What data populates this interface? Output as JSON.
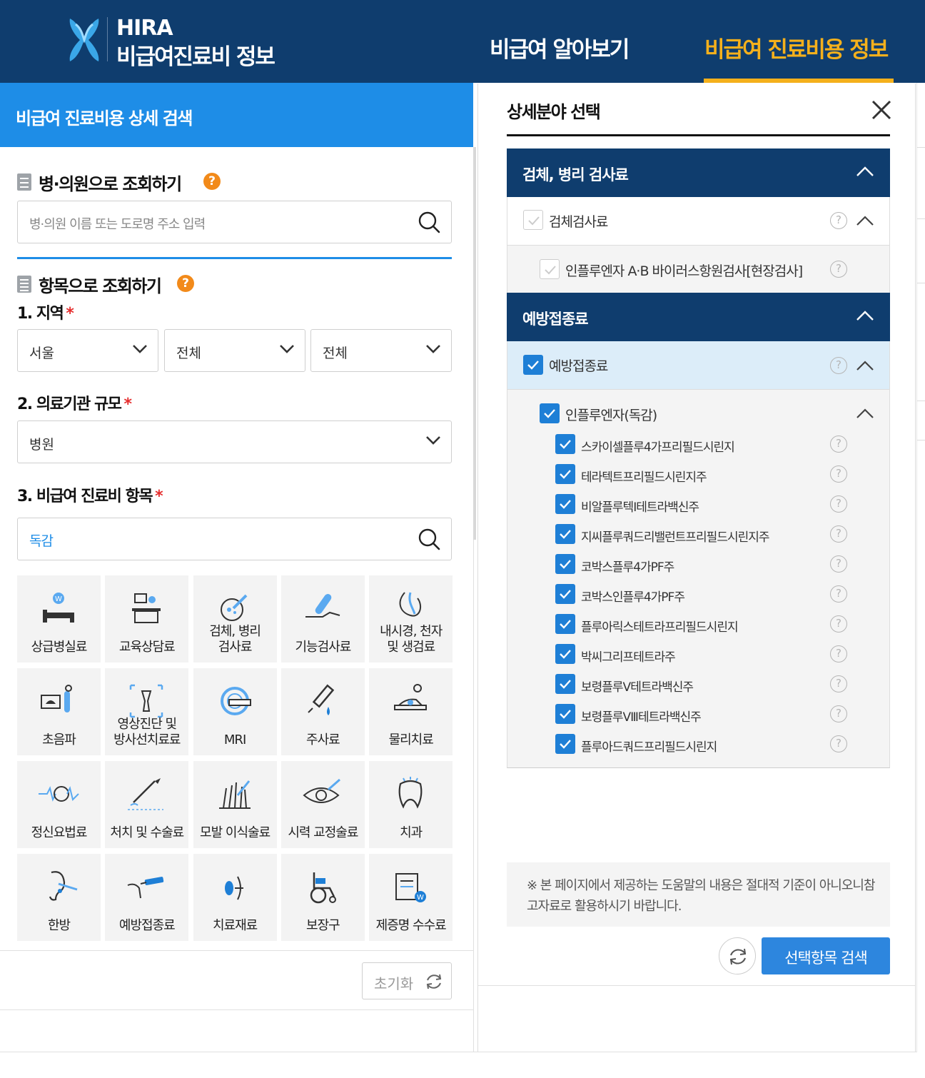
{
  "header": {
    "logo_top": "HIRA",
    "logo_bottom": "비급여진료비 정보",
    "nav": [
      "비급여 알아보기",
      "비급여 진료비용 정보"
    ]
  },
  "left": {
    "title": "비급여 진료비용 상세 검색",
    "hospital_section": {
      "title": "병·의원으로 조회하기",
      "placeholder": "병·의원 이름 또는 도로명 주소 입력"
    },
    "item_section": {
      "title": "항목으로 조회하기",
      "region_label": "1. 지역",
      "region_values": [
        "서울",
        "전체",
        "전체"
      ],
      "scale_label": "2. 의료기관 규모",
      "scale_value": "병원",
      "item_label": "3. 비급여 진료비 항목",
      "item_value": "독감"
    },
    "tiles": [
      {
        "label": "상급병실료",
        "icon": "bed-icon"
      },
      {
        "label": "교육상담료",
        "icon": "consult-icon"
      },
      {
        "label": "검체, 병리\n검사료",
        "icon": "specimen-icon"
      },
      {
        "label": "기능검사료",
        "icon": "thermometer-icon"
      },
      {
        "label": "내시경, 천자\n및 생검료",
        "icon": "endoscope-icon"
      },
      {
        "label": "초음파",
        "icon": "ultrasound-icon"
      },
      {
        "label": "영상진단 및\n방사선치료료",
        "icon": "xray-icon"
      },
      {
        "label": "MRI",
        "icon": "mri-icon"
      },
      {
        "label": "주사료",
        "icon": "syringe-icon"
      },
      {
        "label": "물리치료",
        "icon": "physio-icon"
      },
      {
        "label": "정신요법료",
        "icon": "brain-icon"
      },
      {
        "label": "처치 및 수술료",
        "icon": "scalpel-icon"
      },
      {
        "label": "모발 이식술료",
        "icon": "hair-icon"
      },
      {
        "label": "시력 교정술료",
        "icon": "eye-icon"
      },
      {
        "label": "치과",
        "icon": "tooth-icon"
      },
      {
        "label": "한방",
        "icon": "ear-acupuncture-icon"
      },
      {
        "label": "예방접종료",
        "icon": "vaccine-icon"
      },
      {
        "label": "치료재료",
        "icon": "material-icon"
      },
      {
        "label": "보장구",
        "icon": "wheelchair-icon"
      },
      {
        "label": "제증명 수수료",
        "icon": "certificate-icon"
      }
    ],
    "reset_label": "초기화"
  },
  "modal": {
    "title": "상세분야 선택",
    "categories": [
      {
        "title": "검체, 병리 검사료",
        "sub": {
          "label": "검체검사료",
          "checked": false
        },
        "items": [
          {
            "label": "인플루엔자 A·B 바이러스항원검사[현장검사]",
            "checked": false
          }
        ]
      },
      {
        "title": "예방접종료",
        "sub": {
          "label": "예방접종료",
          "checked": true
        },
        "group": {
          "label": "인플루엔자(독감)",
          "checked": true
        },
        "items": [
          {
            "label": "스카이셀플루4가프리필드시린지",
            "checked": true
          },
          {
            "label": "테라텍트프리필드시린지주",
            "checked": true
          },
          {
            "label": "비알플루텍I테트라백신주",
            "checked": true
          },
          {
            "label": "지씨플루쿼드리밸런트프리필드시린지주",
            "checked": true
          },
          {
            "label": "코박스플루4가PF주",
            "checked": true
          },
          {
            "label": "코박스인플루4가PF주",
            "checked": true
          },
          {
            "label": "플루아릭스테트라프리필드시린지",
            "checked": true
          },
          {
            "label": "박씨그리프테트라주",
            "checked": true
          },
          {
            "label": "보령플루Ⅴ테트라백신주",
            "checked": true
          },
          {
            "label": "보령플루Ⅷ테트라백신주",
            "checked": true
          },
          {
            "label": "플루아드쿼드프리필드시린지",
            "checked": true
          }
        ]
      }
    ],
    "notice": "※ 본 페이지에서 제공하는 도움말의 내용은 절대적 기준이 아니오니참고자료로 활용하시기 바랍니다.",
    "search_label": "선택항목 검색"
  },
  "colors": {
    "navy": "#0f3d6e",
    "accent_blue": "#1e8de7",
    "gold": "#f4b01c",
    "check_blue": "#1e7fd6",
    "required": "#e52d2d"
  }
}
